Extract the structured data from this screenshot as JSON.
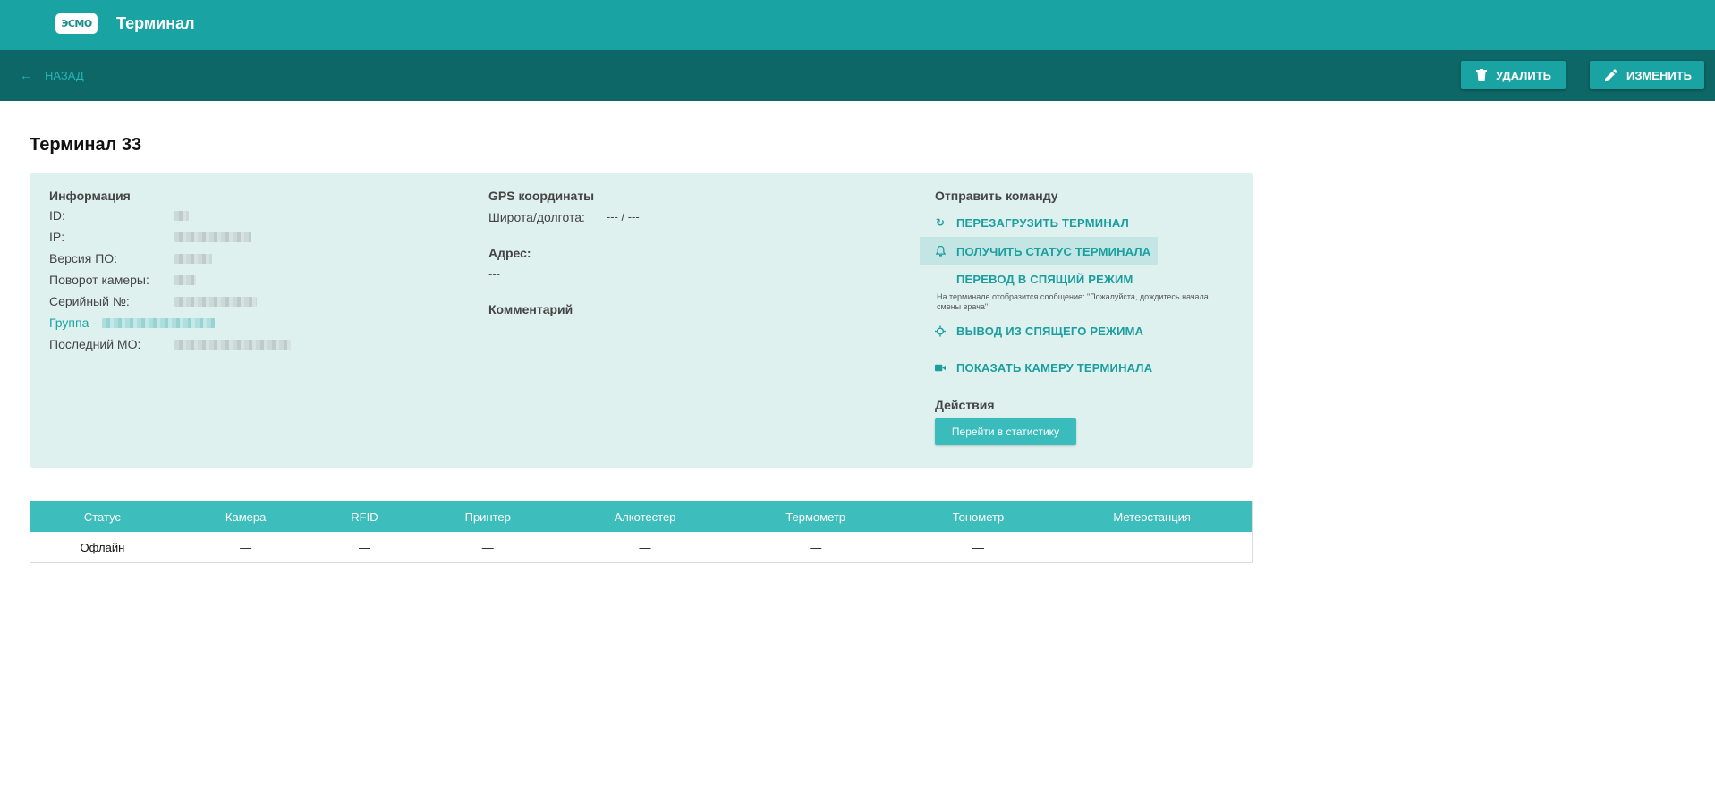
{
  "header": {
    "logo_text": "ЭСМО",
    "app_title": "Терминал"
  },
  "toolbar": {
    "back_label": "НАЗАД",
    "delete_label": "УДАЛИТЬ",
    "edit_label": "ИЗМЕНИТЬ"
  },
  "page": {
    "title": "Терминал 33"
  },
  "info": {
    "heading": "Информация",
    "fields": {
      "id": "ID:",
      "ip": "IP:",
      "version": "Версия ПО:",
      "rotation": "Поворот камеры:",
      "serial": "Серийный №:",
      "group": "Группа -",
      "last_mo": "Последний МО:"
    }
  },
  "gps": {
    "heading": "GPS координаты",
    "coords_label": "Широта/долгота:",
    "coords_value": "--- / ---",
    "address_heading": "Адрес:",
    "address_value": "---",
    "comment_heading": "Комментарий"
  },
  "commands": {
    "heading": "Отправить команду",
    "reboot": "ПЕРЕЗАГРУЗИТЬ ТЕРМИНАЛ",
    "status": "ПОЛУЧИТЬ СТАТУС ТЕРМИНАЛА",
    "sleep": "ПЕРЕВОД В СПЯЩИЙ РЕЖИМ",
    "sleep_note": "На терминале отобразится сообщение: \"Пожалуйста, дождитесь начала смены врача\"",
    "wake": "ВЫВОД ИЗ СПЯЩЕГО РЕЖИМА",
    "camera": "ПОКАЗАТЬ КАМЕРУ ТЕРМИНАЛА",
    "actions_heading": "Действия",
    "stats_button": "Перейти в статистику"
  },
  "status_table": {
    "headers": [
      "Статус",
      "Камера",
      "RFID",
      "Принтер",
      "Алкотестер",
      "Термометр",
      "Тонометр",
      "Метеостанция"
    ],
    "row": [
      "Офлайн",
      "—",
      "—",
      "—",
      "—",
      "—",
      "—",
      ""
    ]
  }
}
